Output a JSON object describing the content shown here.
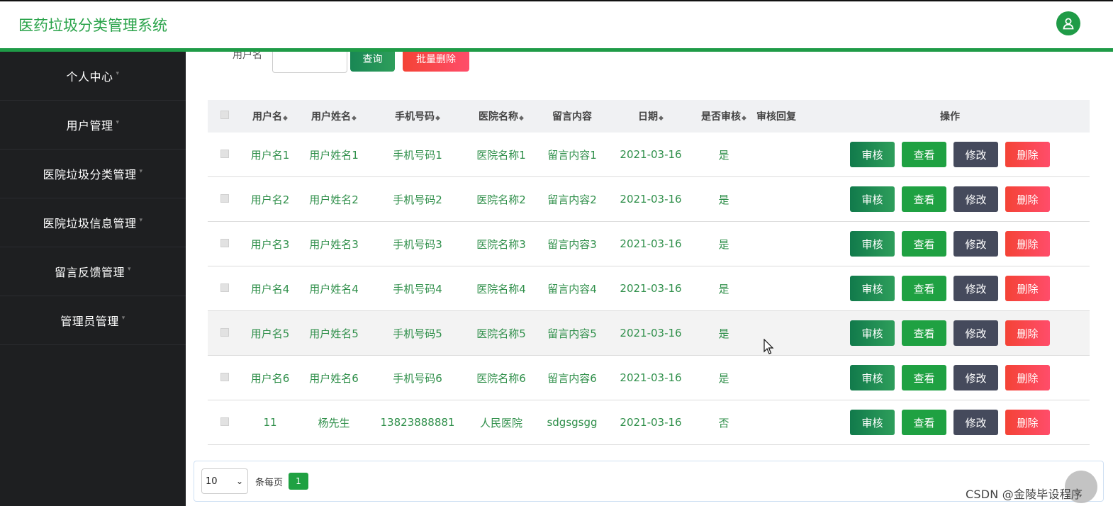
{
  "app": {
    "title": "医药垃圾分类管理系统",
    "avatar_icon": "user-icon",
    "accent": "#1f9b47"
  },
  "sidebar": {
    "items": [
      {
        "label": "个人中心"
      },
      {
        "label": "用户管理"
      },
      {
        "label": "医院垃圾分类管理"
      },
      {
        "label": "医院垃圾信息管理"
      },
      {
        "label": "留言反馈管理"
      },
      {
        "label": "管理员管理"
      }
    ]
  },
  "search": {
    "username_label": "用户名",
    "username_value": "",
    "query_label": "查询",
    "batch_delete_label": "批量删除"
  },
  "table": {
    "headers": [
      "用户名",
      "用户姓名",
      "手机号码",
      "医院名称",
      "留言内容",
      "日期",
      "是否审核",
      "审核回复",
      "操作"
    ],
    "sort_icon": "sort-icon",
    "rows": [
      {
        "username": "用户名1",
        "realname": "用户姓名1",
        "phone": "手机号码1",
        "hospital": "医院名称1",
        "message": "留言内容1",
        "date": "2021-03-16",
        "audited": "是",
        "reply": ""
      },
      {
        "username": "用户名2",
        "realname": "用户姓名2",
        "phone": "手机号码2",
        "hospital": "医院名称2",
        "message": "留言内容2",
        "date": "2021-03-16",
        "audited": "是",
        "reply": ""
      },
      {
        "username": "用户名3",
        "realname": "用户姓名3",
        "phone": "手机号码3",
        "hospital": "医院名称3",
        "message": "留言内容3",
        "date": "2021-03-16",
        "audited": "是",
        "reply": ""
      },
      {
        "username": "用户名4",
        "realname": "用户姓名4",
        "phone": "手机号码4",
        "hospital": "医院名称4",
        "message": "留言内容4",
        "date": "2021-03-16",
        "audited": "是",
        "reply": ""
      },
      {
        "username": "用户名5",
        "realname": "用户姓名5",
        "phone": "手机号码5",
        "hospital": "医院名称5",
        "message": "留言内容5",
        "date": "2021-03-16",
        "audited": "是",
        "reply": ""
      },
      {
        "username": "用户名6",
        "realname": "用户姓名6",
        "phone": "手机号码6",
        "hospital": "医院名称6",
        "message": "留言内容6",
        "date": "2021-03-16",
        "audited": "是",
        "reply": ""
      },
      {
        "username": "11",
        "realname": "杨先生",
        "phone": "13823888881",
        "hospital": "人民医院",
        "message": "sdgsgsgg",
        "date": "2021-03-16",
        "audited": "否",
        "reply": ""
      }
    ],
    "actions": {
      "audit": "审核",
      "view": "查看",
      "edit": "修改",
      "delete": "删除"
    }
  },
  "pager": {
    "page_size": "10",
    "per_page_label": "条每页",
    "current_page": "1"
  },
  "watermark": "CSDN @金陵毕设程序"
}
